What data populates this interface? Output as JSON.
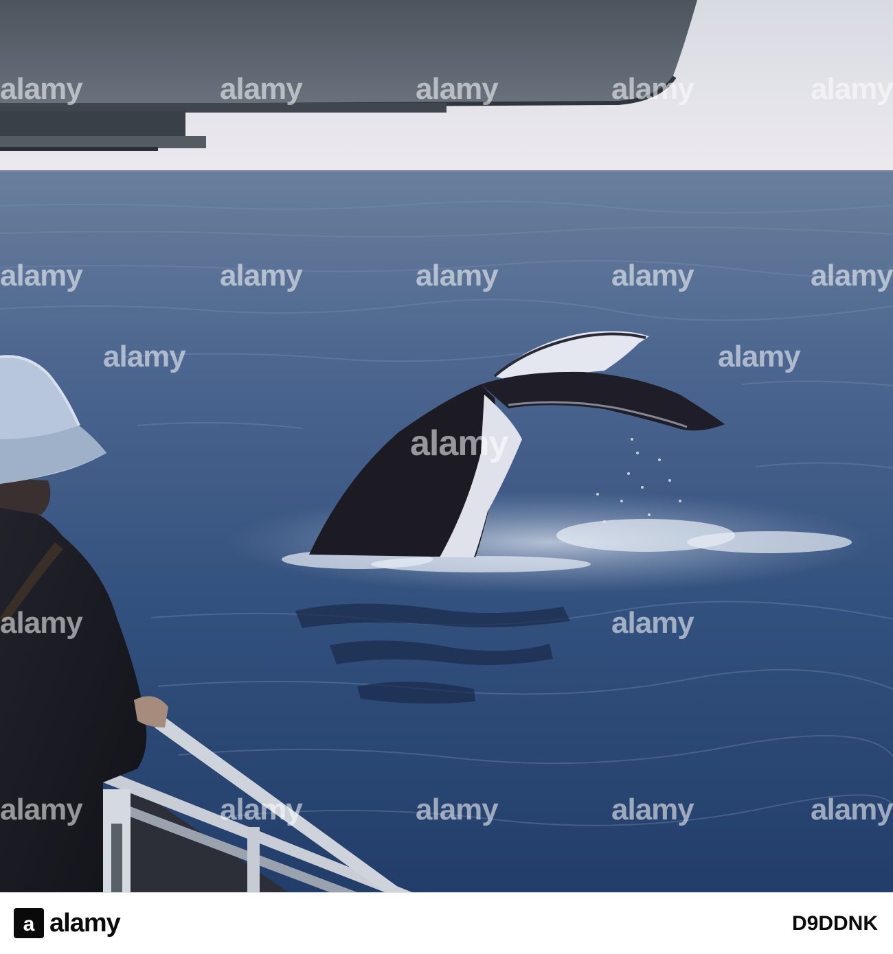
{
  "photo": {
    "description_icon": "whale-tail-fluke",
    "colors": {
      "sky": "#e6e6ec",
      "sea_far": "#5a7294",
      "sea_near": "#274371",
      "roof": "#5d6670",
      "tail": "#1c1b24"
    }
  },
  "watermark": {
    "text": "alamy"
  },
  "footer": {
    "brand": "alamy",
    "image_id": "D9DDNK"
  }
}
